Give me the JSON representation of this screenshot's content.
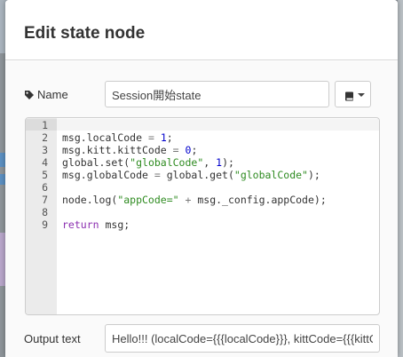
{
  "dialog": {
    "title": "Edit state node"
  },
  "name_row": {
    "label": "Name",
    "value": "Session開始state"
  },
  "editor": {
    "lines": [
      {
        "n": "1",
        "tokens": []
      },
      {
        "n": "2",
        "tokens": [
          [
            "msg.localCode ",
            ""
          ],
          [
            "=",
            "op"
          ],
          [
            " ",
            ""
          ],
          [
            "1",
            "num"
          ],
          [
            ";",
            ""
          ]
        ]
      },
      {
        "n": "3",
        "tokens": [
          [
            "msg.kitt.kittCode ",
            ""
          ],
          [
            "=",
            "op"
          ],
          [
            " ",
            ""
          ],
          [
            "0",
            "num"
          ],
          [
            ";",
            ""
          ]
        ]
      },
      {
        "n": "4",
        "tokens": [
          [
            "global.set(",
            ""
          ],
          [
            "\"globalCode\"",
            "str"
          ],
          [
            ", ",
            ""
          ],
          [
            "1",
            "num"
          ],
          [
            ");",
            ""
          ]
        ]
      },
      {
        "n": "5",
        "tokens": [
          [
            "msg.globalCode ",
            ""
          ],
          [
            "=",
            "op"
          ],
          [
            " global.get(",
            ""
          ],
          [
            "\"globalCode\"",
            "str"
          ],
          [
            ");",
            ""
          ]
        ]
      },
      {
        "n": "6",
        "tokens": []
      },
      {
        "n": "7",
        "tokens": [
          [
            "node.log(",
            ""
          ],
          [
            "\"appCode=\"",
            "str"
          ],
          [
            " ",
            ""
          ],
          [
            "+",
            "op"
          ],
          [
            " msg._config.appCode);",
            ""
          ]
        ]
      },
      {
        "n": "8",
        "tokens": []
      },
      {
        "n": "9",
        "tokens": [
          [
            "return",
            "kw"
          ],
          [
            " msg;",
            ""
          ]
        ]
      }
    ]
  },
  "output_row": {
    "label": "Output text",
    "value": "Hello!!! (localCode={{{localCode}}}, kittCode={{{kittCode}}})"
  },
  "icons": {
    "name": "tag-icon",
    "library": "book-icon",
    "dropdown": "caret-down-icon"
  }
}
